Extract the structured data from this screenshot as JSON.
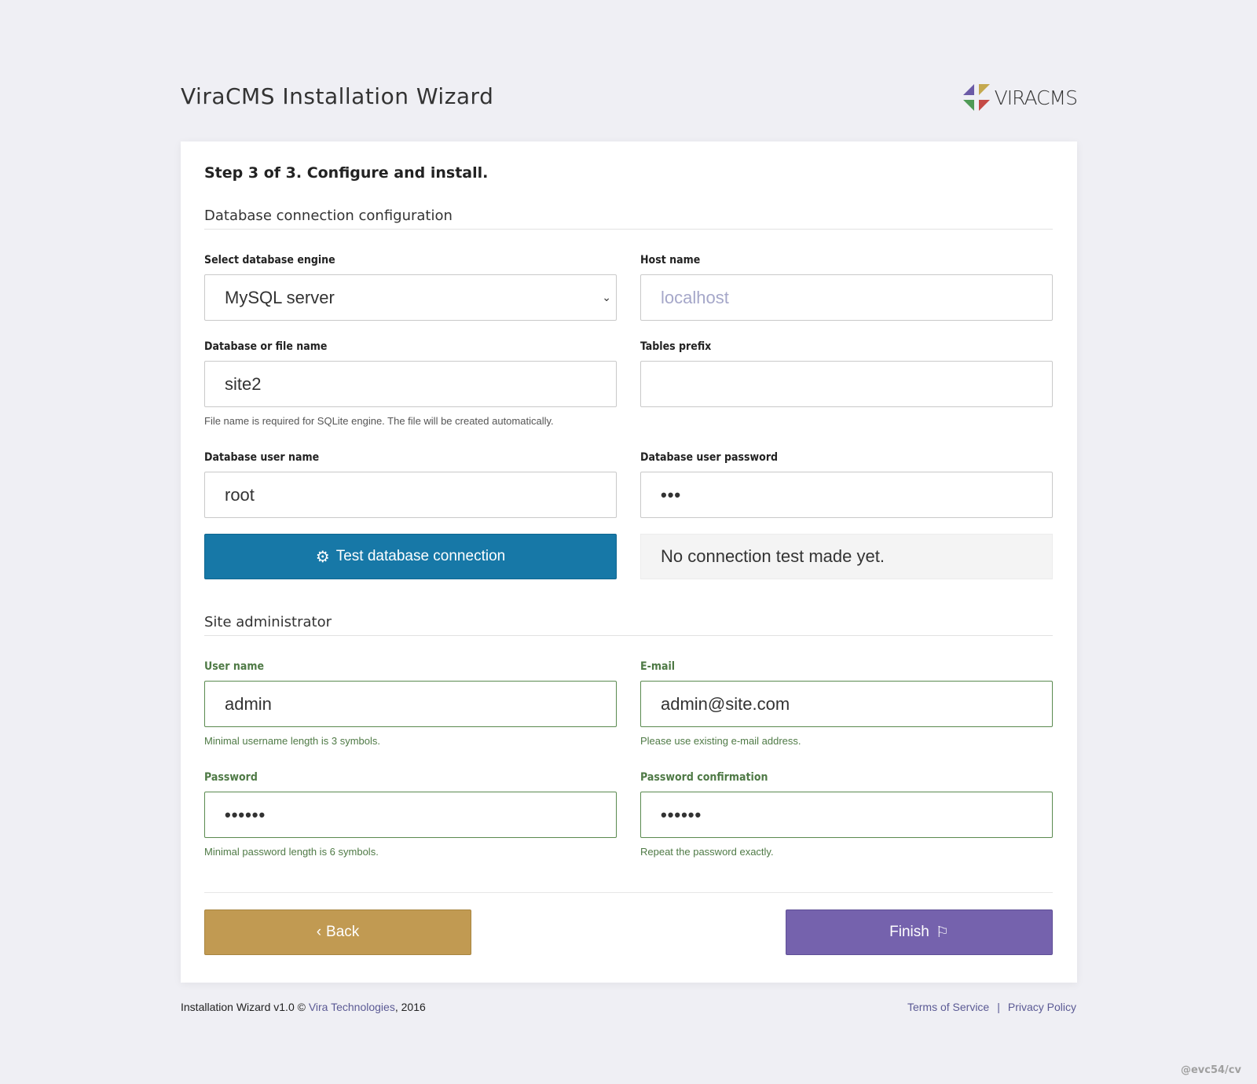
{
  "header": {
    "title": "ViraCMS Installation Wizard",
    "logo_text": "VIRACMS"
  },
  "step_title": "Step 3 of 3. Configure and install.",
  "db_section": {
    "title": "Database connection configuration",
    "engine": {
      "label": "Select database engine",
      "value": "MySQL server"
    },
    "host": {
      "label": "Host name",
      "placeholder": "localhost"
    },
    "db_name": {
      "label": "Database or file name",
      "value": "site2",
      "hint": "File name is required for SQLite engine. The file will be created automatically."
    },
    "prefix": {
      "label": "Tables prefix",
      "value": ""
    },
    "db_user": {
      "label": "Database user name",
      "value": "root"
    },
    "db_password": {
      "label": "Database user password",
      "value": "•••"
    },
    "test_button": "Test database connection",
    "test_status": "No connection test made yet."
  },
  "admin_section": {
    "title": "Site administrator",
    "username": {
      "label": "User name",
      "value": "admin",
      "hint": "Minimal username length is 3 symbols."
    },
    "email": {
      "label": "E-mail",
      "value": "admin@site.com",
      "hint": "Please use existing e-mail address."
    },
    "password": {
      "label": "Password",
      "value": "••••••",
      "hint": "Minimal password length is 6 symbols."
    },
    "password_confirm": {
      "label": "Password confirmation",
      "value": "••••••",
      "hint": "Repeat the password exactly."
    }
  },
  "actions": {
    "back": "Back",
    "finish": "Finish"
  },
  "footer": {
    "prefix": "Installation Wizard v1.0 © ",
    "company": "Vira Technologies",
    "suffix": ", 2016",
    "terms": "Terms of Service",
    "separator": "|",
    "privacy": "Privacy Policy"
  },
  "watermark": "@evc54/cv",
  "colors": {
    "primary": "#1778a7",
    "back": "#c19a52",
    "finish": "#7562ad",
    "success": "#4f7a46",
    "link": "#5b5a94"
  }
}
